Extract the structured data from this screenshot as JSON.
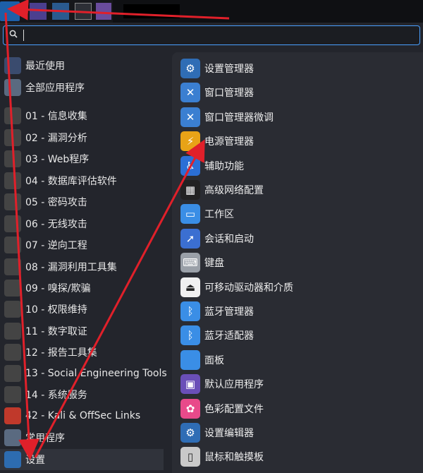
{
  "search": {
    "value": "",
    "placeholder": ""
  },
  "categories": [
    {
      "label": "最近使用",
      "icon": "recent-icon",
      "color": "#3a4b6e"
    },
    {
      "label": "全部应用程序",
      "icon": "all-apps-icon",
      "color": "#5a6a80"
    },
    {
      "label": "01 - 信息收集",
      "icon": "info-gathering-icon",
      "color": "#444"
    },
    {
      "label": "02 - 漏洞分析",
      "icon": "vuln-analysis-icon",
      "color": "#444"
    },
    {
      "label": "03 - Web程序",
      "icon": "web-icon",
      "color": "#444"
    },
    {
      "label": "04 - 数据库评估软件",
      "icon": "database-icon",
      "color": "#444"
    },
    {
      "label": "05 - 密码攻击",
      "icon": "password-icon",
      "color": "#444"
    },
    {
      "label": "06 - 无线攻击",
      "icon": "wireless-icon",
      "color": "#444"
    },
    {
      "label": "07 - 逆向工程",
      "icon": "reverse-icon",
      "color": "#444"
    },
    {
      "label": "08 - 漏洞利用工具集",
      "icon": "exploit-icon",
      "color": "#444"
    },
    {
      "label": "09 - 嗅探/欺骗",
      "icon": "sniff-icon",
      "color": "#444"
    },
    {
      "label": "10 - 权限维持",
      "icon": "persistence-icon",
      "color": "#444"
    },
    {
      "label": "11 - 数字取证",
      "icon": "forensics-icon",
      "color": "#444"
    },
    {
      "label": "12 - 报告工具集",
      "icon": "report-icon",
      "color": "#444"
    },
    {
      "label": "13 - Social Engineering Tools",
      "icon": "social-icon",
      "color": "#444"
    },
    {
      "label": "14 - 系统服务",
      "icon": "services-icon",
      "color": "#444"
    },
    {
      "label": "42 - Kali & OffSec Links",
      "icon": "kali-links-icon",
      "color": "#c0392b"
    },
    {
      "label": "常用程序",
      "icon": "common-apps-icon",
      "color": "#5a6a80"
    },
    {
      "label": "设置",
      "icon": "settings-icon",
      "color": "#2d6cb0"
    }
  ],
  "settings_apps": [
    {
      "label": "设置管理器",
      "icon": "settings-manager-icon",
      "color": "#2f6db5",
      "glyph": "⚙"
    },
    {
      "label": "窗口管理器",
      "icon": "window-manager-icon",
      "color": "#3b7fd1",
      "glyph": "✕"
    },
    {
      "label": "窗口管理器微调",
      "icon": "window-tweaks-icon",
      "color": "#3b7fd1",
      "glyph": "✕"
    },
    {
      "label": "电源管理器",
      "icon": "power-manager-icon",
      "color": "#e8a317",
      "glyph": "⚡"
    },
    {
      "label": "辅助功能",
      "icon": "accessibility-icon",
      "color": "#2b6fd6",
      "glyph": "♿"
    },
    {
      "label": "高级网络配置",
      "icon": "network-icon",
      "color": "#222",
      "glyph": "▦"
    },
    {
      "label": "工作区",
      "icon": "workspace-icon",
      "color": "#3a8ee6",
      "glyph": "▭"
    },
    {
      "label": "会话和启动",
      "icon": "session-icon",
      "color": "#3b6fd1",
      "glyph": "➚"
    },
    {
      "label": "键盘",
      "icon": "keyboard-icon",
      "color": "#9aa0a8",
      "glyph": "⌨"
    },
    {
      "label": "可移动驱动器和介质",
      "icon": "removable-icon",
      "color": "#f0f0f0",
      "glyph": "⏏"
    },
    {
      "label": "蓝牙管理器",
      "icon": "bluetooth-manager-icon",
      "color": "#3a8ee6",
      "glyph": "ᛒ"
    },
    {
      "label": "蓝牙适配器",
      "icon": "bluetooth-adapter-icon",
      "color": "#3a8ee6",
      "glyph": "ᛒ"
    },
    {
      "label": "面板",
      "icon": "panel-icon",
      "color": "#3a8ee6",
      "glyph": ""
    },
    {
      "label": "默认应用程序",
      "icon": "default-apps-icon",
      "color": "#6a4fb8",
      "glyph": "▣"
    },
    {
      "label": "色彩配置文件",
      "icon": "color-profile-icon",
      "color": "#e84a8a",
      "glyph": "✿"
    },
    {
      "label": "设置编辑器",
      "icon": "settings-editor-icon",
      "color": "#2f6db5",
      "glyph": "⚙"
    },
    {
      "label": "鼠标和触摸板",
      "icon": "mouse-icon",
      "color": "#c9c9c9",
      "glyph": "▯"
    }
  ],
  "colors": {
    "accent": "#4aa0ff",
    "annotation_arrow": "#e0202a"
  }
}
